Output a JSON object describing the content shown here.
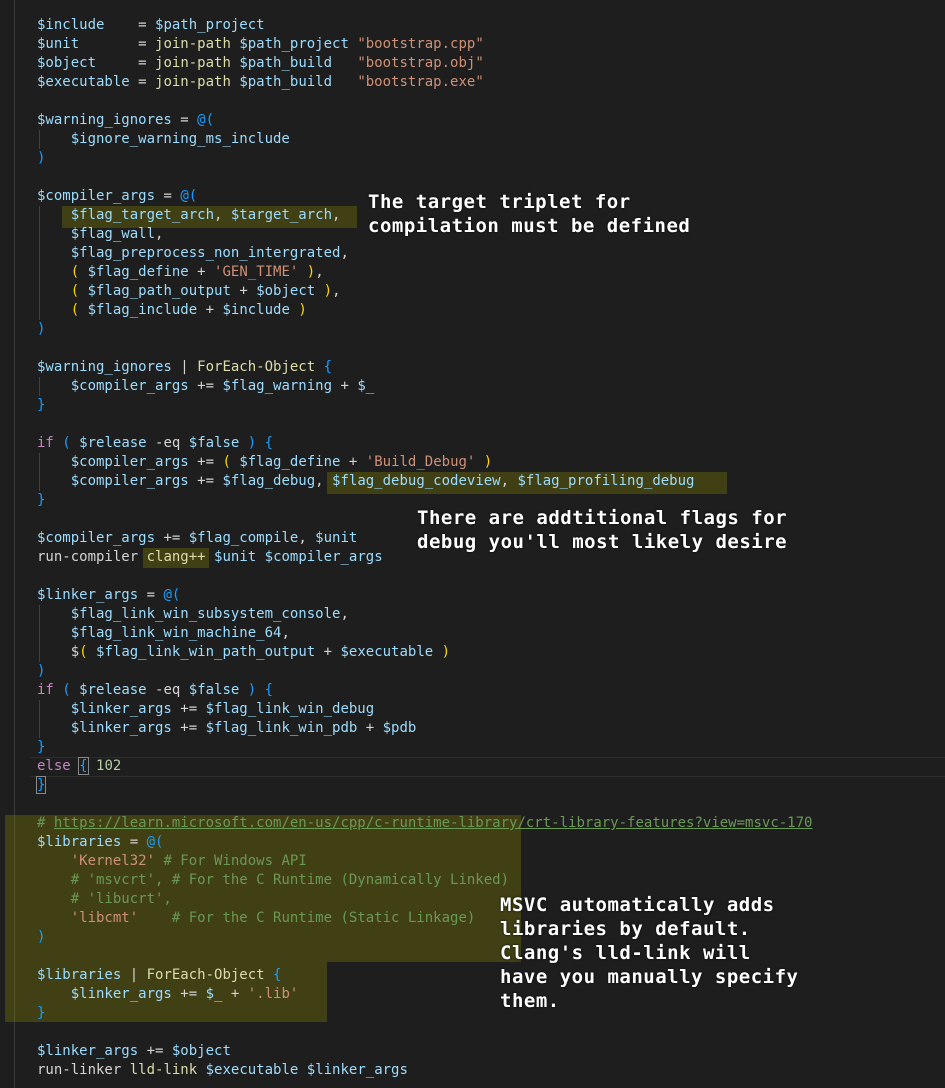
{
  "annotations": {
    "triplet": [
      "The target triplet for",
      "compilation must be defined"
    ],
    "debug": [
      "There are addtitional flags for",
      "debug you'll most likely desire"
    ],
    "msvc": [
      "MSVC automatically adds",
      "libraries by default.",
      "Clang's lld-link will",
      "have you manually specify",
      "them."
    ]
  },
  "code": {
    "include_var": "$include",
    "include_val": "$path_project",
    "unit_var": "$unit",
    "join_path": "join-path",
    "path_project": "$path_project",
    "bootstrap_cpp": "\"bootstrap.cpp\"",
    "object_var": "$object",
    "path_build": "$path_build",
    "bootstrap_obj": "\"bootstrap.obj\"",
    "executable_var": "$executable",
    "bootstrap_exe": "\"bootstrap.exe\"",
    "warning_ignores": "$warning_ignores",
    "ignore_warning": "$ignore_warning_ms_include",
    "compiler_args": "$compiler_args",
    "flag_target_arch": "$flag_target_arch",
    "target_arch": "$target_arch",
    "flag_wall": "$flag_wall",
    "flag_preprocess": "$flag_preprocess_non_intergrated",
    "flag_define": "$flag_define",
    "gen_time": "'GEN_TIME'",
    "flag_path_output": "$flag_path_output",
    "flag_include": "$flag_include",
    "foreach": "ForEach-Object",
    "flag_warning": "$flag_warning",
    "underscore": "$_",
    "if_kw": "if",
    "release": "$release",
    "eq": "-eq",
    "false_kw": "$false",
    "build_debug": "'Build_Debug'",
    "flag_debug": "$flag_debug",
    "flag_debug_codeview": "$flag_debug_codeview",
    "flag_profiling_debug": "$flag_profiling_debug",
    "flag_compile": "$flag_compile",
    "run_compiler": "run-compiler",
    "clang": "clang++",
    "linker_args": "$linker_args",
    "flag_link_console": "$flag_link_win_subsystem_console",
    "flag_link_machine": "$flag_link_win_machine_64",
    "flag_link_path_output": "$flag_link_win_path_output",
    "flag_link_debug": "$flag_link_win_debug",
    "flag_link_pdb": "$flag_link_win_pdb",
    "pdb": "$pdb",
    "else_kw": "else",
    "else_num": "102",
    "url_comment_hash": "#",
    "url": "https://learn.microsoft.com/en-us/cpp/c-runtime-library/crt-library-features?view=msvc-170",
    "libraries": "$libraries",
    "kernel32": "'Kernel32'",
    "kernel32_comment": "# For Windows API",
    "msvcrt_comment": "# 'msvcrt', # For the C Runtime (Dynamically Linked)",
    "libucrt_comment": "# 'libucrt',",
    "libcmt": "'libcmt'",
    "libcmt_comment": "# For the C Runtime (Static Linkage)",
    "lib_ext": "'.lib'",
    "run_linker": "run-linker",
    "lld_link": "lld-link"
  }
}
